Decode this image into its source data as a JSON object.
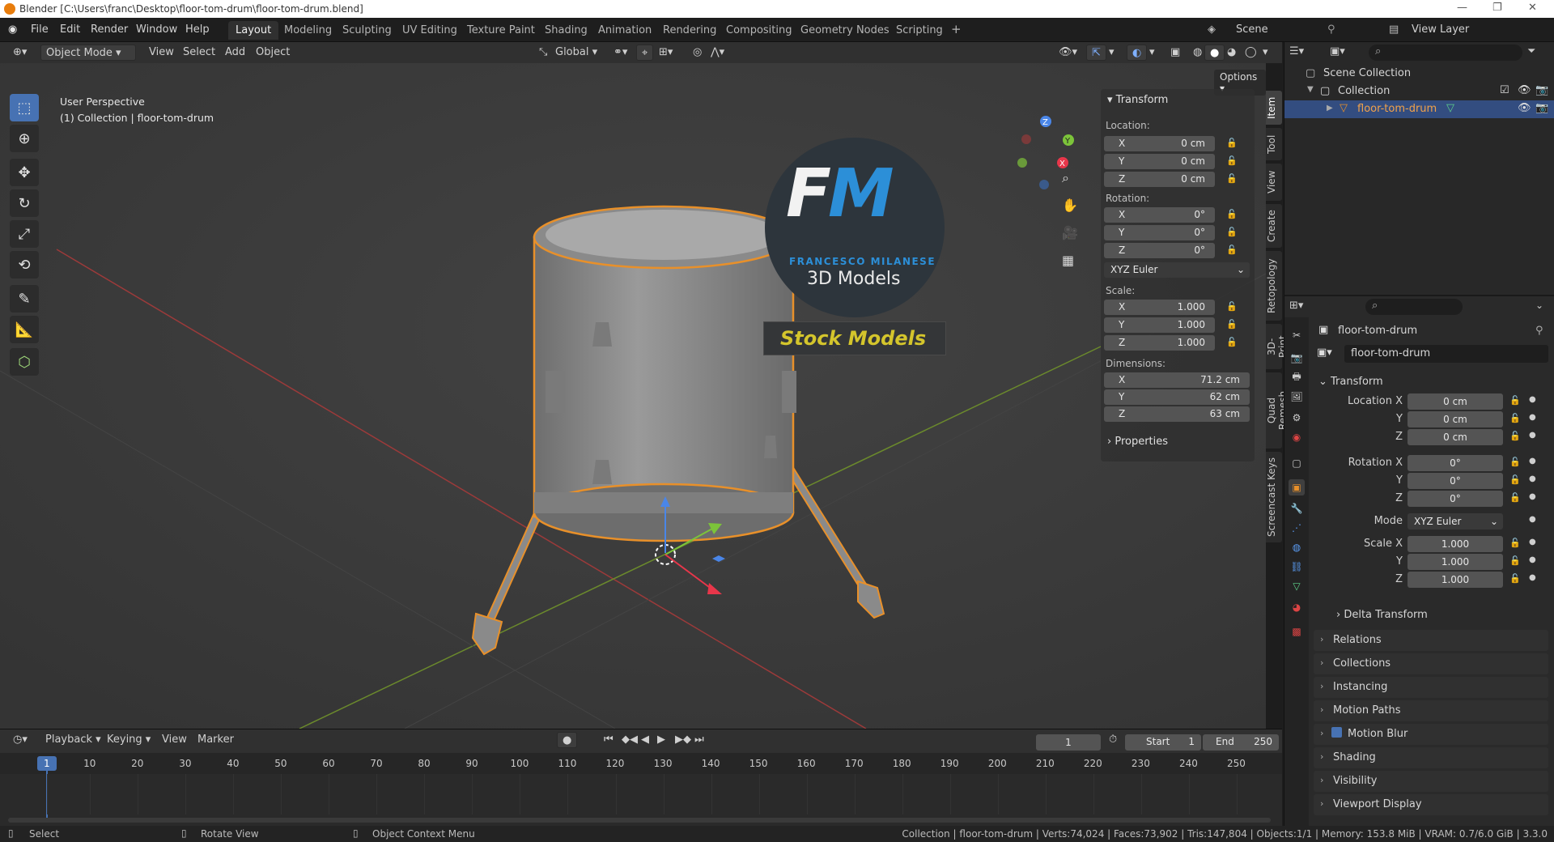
{
  "titlebar": {
    "title": "Blender [C:\\Users\\franc\\Desktop\\floor-tom-drum\\floor-tom-drum.blend]"
  },
  "menu": {
    "items": [
      "File",
      "Edit",
      "Render",
      "Window",
      "Help"
    ]
  },
  "workspaces": [
    "Layout",
    "Modeling",
    "Sculpting",
    "UV Editing",
    "Texture Paint",
    "Shading",
    "Animation",
    "Rendering",
    "Compositing",
    "Geometry Nodes",
    "Scripting"
  ],
  "scene": {
    "label": "Scene",
    "view_layer": "View Layer"
  },
  "viewport_header": {
    "mode": "Object Mode",
    "menus": [
      "View",
      "Select",
      "Add",
      "Object"
    ],
    "orientation": "Global",
    "options": "Options"
  },
  "viewport": {
    "perspective": "User Perspective",
    "collection_info": "(1) Collection | floor-tom-drum"
  },
  "logo": {
    "letters": "FM",
    "brand": "FRANCESCO MILANESE",
    "subtitle": "3D Models",
    "banner": "Stock Models"
  },
  "npanel": {
    "title": "Transform",
    "location_label": "Location:",
    "location": [
      {
        "axis": "X",
        "value": "0 cm"
      },
      {
        "axis": "Y",
        "value": "0 cm"
      },
      {
        "axis": "Z",
        "value": "0 cm"
      }
    ],
    "rotation_label": "Rotation:",
    "rotation": [
      {
        "axis": "X",
        "value": "0°"
      },
      {
        "axis": "Y",
        "value": "0°"
      },
      {
        "axis": "Z",
        "value": "0°"
      }
    ],
    "rotation_mode": "XYZ Euler",
    "scale_label": "Scale:",
    "scale": [
      {
        "axis": "X",
        "value": "1.000"
      },
      {
        "axis": "Y",
        "value": "1.000"
      },
      {
        "axis": "Z",
        "value": "1.000"
      }
    ],
    "dimensions_label": "Dimensions:",
    "dimensions": [
      {
        "axis": "X",
        "value": "71.2 cm"
      },
      {
        "axis": "Y",
        "value": "62 cm"
      },
      {
        "axis": "Z",
        "value": "63 cm"
      }
    ],
    "properties": "Properties"
  },
  "side_tabs": [
    "Item",
    "Tool",
    "View",
    "Create",
    "Retopology",
    "3D-Print",
    "Quad Remesh",
    "Screencast Keys"
  ],
  "outliner": {
    "root": "Scene Collection",
    "collection": "Collection",
    "object": "floor-tom-drum"
  },
  "properties": {
    "object_name": "floor-tom-drum",
    "data_name": "floor-tom-drum",
    "transform": "Transform",
    "location_x": "Location X",
    "y": "Y",
    "z": "Z",
    "rotation_x": "Rotation X",
    "mode_label": "Mode",
    "mode": "XYZ Euler",
    "scale_x": "Scale X",
    "loc_values": [
      "0 cm",
      "0 cm",
      "0 cm"
    ],
    "rot_values": [
      "0°",
      "0°",
      "0°"
    ],
    "scale_values": [
      "1.000",
      "1.000",
      "1.000"
    ],
    "delta": "Delta Transform",
    "sections": [
      "Relations",
      "Collections",
      "Instancing",
      "Motion Paths",
      "Motion Blur",
      "Shading",
      "Visibility",
      "Viewport Display"
    ]
  },
  "timeline": {
    "menus": [
      "Playback",
      "Keying",
      "View",
      "Marker"
    ],
    "current_frame": "1",
    "start_label": "Start",
    "start": "1",
    "end_label": "End",
    "end": "250",
    "ticks": [
      "1",
      "10",
      "20",
      "30",
      "40",
      "50",
      "60",
      "70",
      "80",
      "90",
      "100",
      "110",
      "120",
      "130",
      "140",
      "150",
      "160",
      "170",
      "180",
      "190",
      "200",
      "210",
      "220",
      "230",
      "240",
      "250"
    ]
  },
  "statusbar": {
    "select": "Select",
    "rotate": "Rotate View",
    "context": "Object Context Menu",
    "stats": "Collection | floor-tom-drum | Verts:74,024 | Faces:73,902 | Tris:147,804 | Objects:1/1 | Memory: 153.8 MiB | VRAM: 0.7/6.0 GiB | 3.3.0"
  },
  "colors": {
    "accent": "#4772b3",
    "selection": "#e8902a",
    "logo_text": "#d4c52c"
  }
}
